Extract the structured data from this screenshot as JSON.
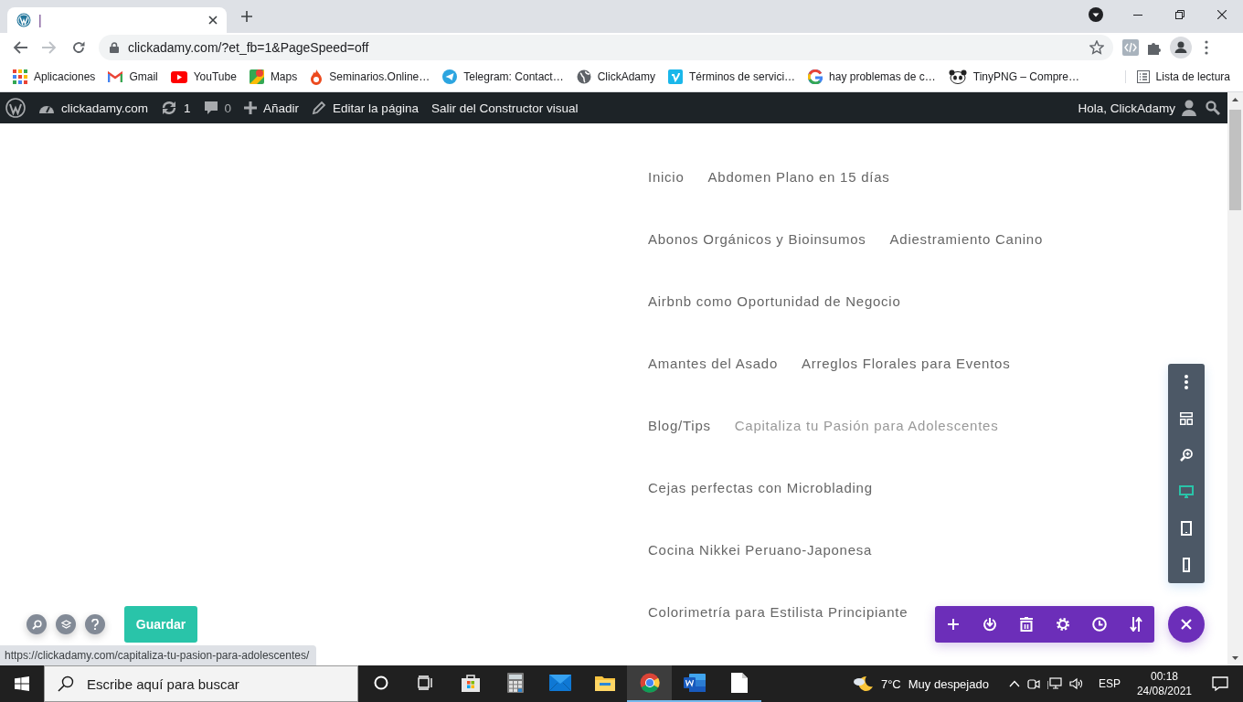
{
  "browser": {
    "tab": {
      "title": "|"
    },
    "address": "clickadamy.com/?et_fb=1&PageSpeed=off",
    "bookmarks": [
      {
        "kind": "apps",
        "label": "Aplicaciones"
      },
      {
        "kind": "gmail",
        "label": "Gmail"
      },
      {
        "kind": "youtube",
        "label": "YouTube"
      },
      {
        "kind": "maps",
        "label": "Maps"
      },
      {
        "kind": "fire",
        "label": "Seminarios.Online…"
      },
      {
        "kind": "telegram",
        "label": "Telegram: Contact…"
      },
      {
        "kind": "globe",
        "label": "ClickAdamy"
      },
      {
        "kind": "vimeo",
        "label": "Términos de servici…"
      },
      {
        "kind": "google",
        "label": "hay problemas de c…"
      },
      {
        "kind": "panda",
        "label": "TinyPNG – Compre…"
      }
    ],
    "reading_list": "Lista de lectura"
  },
  "admin_bar": {
    "site": "clickadamy.com",
    "updates": "1",
    "comments": "0",
    "new": "Añadir",
    "edit": "Editar la página",
    "exit": "Salir del Constructor visual",
    "greeting": "Hola, ClickAdamy"
  },
  "menu_rows": [
    {
      "items": [
        {
          "label": "Inicio",
          "hovered": false
        },
        {
          "label": "Abdomen Plano en 15 días",
          "hovered": false
        }
      ]
    },
    {
      "items": [
        {
          "label": "Abonos Orgánicos y Bioinsumos",
          "hovered": false
        },
        {
          "label": "Adiestramiento Canino",
          "hovered": false
        }
      ]
    },
    {
      "items": [
        {
          "label": "Airbnb como Oportunidad de Negocio",
          "hovered": false
        }
      ]
    },
    {
      "items": [
        {
          "label": "Amantes del Asado",
          "hovered": false
        },
        {
          "label": "Arreglos Florales para Eventos",
          "hovered": false
        }
      ]
    },
    {
      "items": [
        {
          "label": "Blog/Tips",
          "hovered": false
        },
        {
          "label": "Capitaliza tu Pasión para Adolescentes",
          "hovered": true
        }
      ]
    },
    {
      "items": [
        {
          "label": "Cejas perfectas con Microblading",
          "hovered": false
        }
      ]
    },
    {
      "items": [
        {
          "label": "Cocina Nikkei Peruano-Japonesa",
          "hovered": false
        }
      ]
    },
    {
      "items": [
        {
          "label": "Colorimetría para Estilista Principiante",
          "hovered": false
        }
      ]
    }
  ],
  "view_toolbar": [
    {
      "kind": "more",
      "selected": false
    },
    {
      "kind": "layout",
      "selected": false
    },
    {
      "kind": "zoom",
      "selected": false
    },
    {
      "kind": "desktop",
      "selected": true
    },
    {
      "kind": "tablet",
      "selected": false
    },
    {
      "kind": "phone",
      "selected": false
    }
  ],
  "page_toolbar": [
    {
      "kind": "add"
    },
    {
      "kind": "portability"
    },
    {
      "kind": "trash"
    },
    {
      "kind": "settings"
    },
    {
      "kind": "history"
    },
    {
      "kind": "sort"
    }
  ],
  "save_button": "Guardar",
  "status_url": "https://clickadamy.com/capitaliza-tu-pasion-para-adolescentes/",
  "taskbar": {
    "search_placeholder": "Escribe aquí para buscar",
    "apps": [
      {
        "kind": "cortana",
        "running": false,
        "selected": false
      },
      {
        "kind": "taskview",
        "running": false,
        "selected": false
      },
      {
        "kind": "store",
        "running": false,
        "selected": false
      },
      {
        "kind": "calculator",
        "running": false,
        "selected": false
      },
      {
        "kind": "mail",
        "running": false,
        "selected": false
      },
      {
        "kind": "explorer",
        "running": false,
        "selected": false
      },
      {
        "kind": "chrome",
        "running": true,
        "selected": true
      },
      {
        "kind": "word",
        "running": true,
        "selected": false
      },
      {
        "kind": "file",
        "running": true,
        "selected": false
      }
    ],
    "temperature": "7°C",
    "weather": "Muy despejado",
    "language": "ESP",
    "time": "00:18",
    "date": "24/08/2021"
  }
}
